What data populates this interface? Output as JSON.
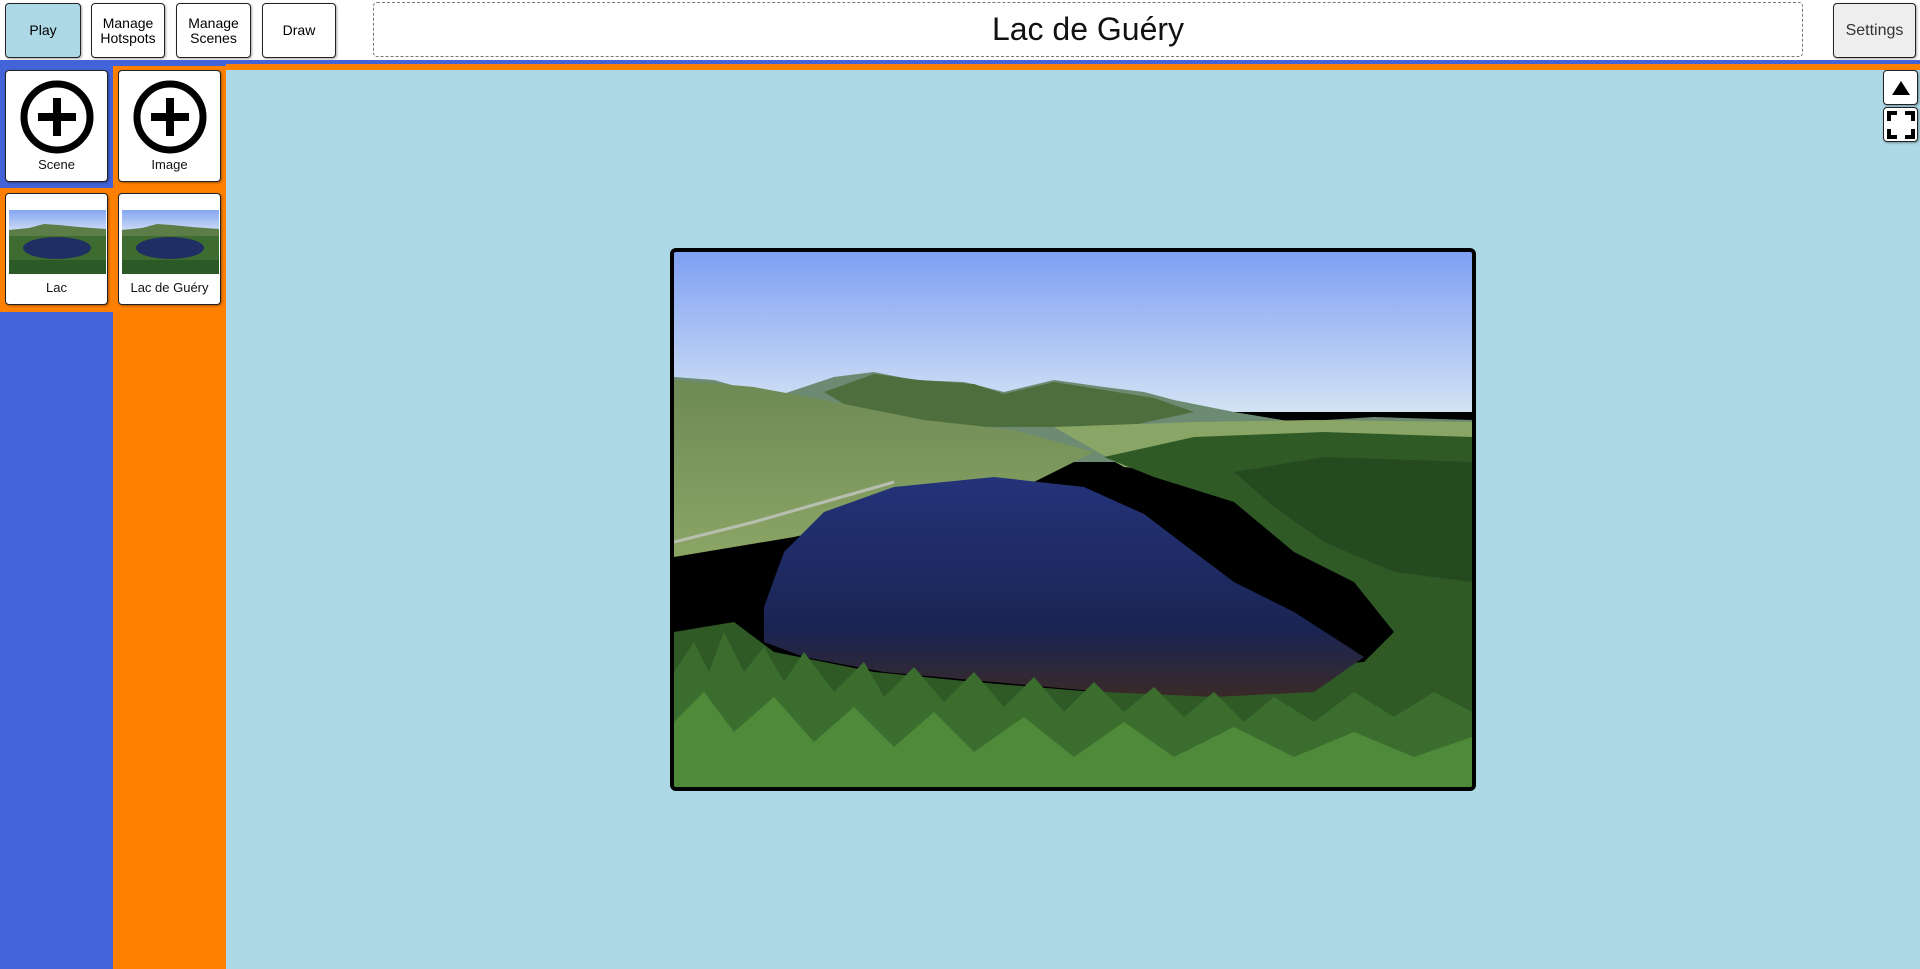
{
  "toolbar": {
    "play_label": "Play",
    "manage_hotspots_label": "Manage\nHotspots",
    "manage_scenes_label": "Manage\nScenes",
    "draw_label": "Draw",
    "settings_label": "Settings",
    "active_mode": "Play"
  },
  "title": "Lac de Guéry",
  "sidebar": {
    "scenes": {
      "add_label": "Scene",
      "items": [
        {
          "label": "Lac",
          "selected": true
        }
      ]
    },
    "images": {
      "add_label": "Image",
      "items": [
        {
          "label": "Lac de Guéry"
        }
      ]
    }
  },
  "controls": {
    "collapse_icon": "triangle-up-icon",
    "fullscreen_icon": "fullscreen-icon"
  },
  "colors": {
    "scenes_column": "#4363d8",
    "images_column": "#ff8000",
    "stage_background": "#add8e6",
    "active_button": "#add8e6"
  }
}
